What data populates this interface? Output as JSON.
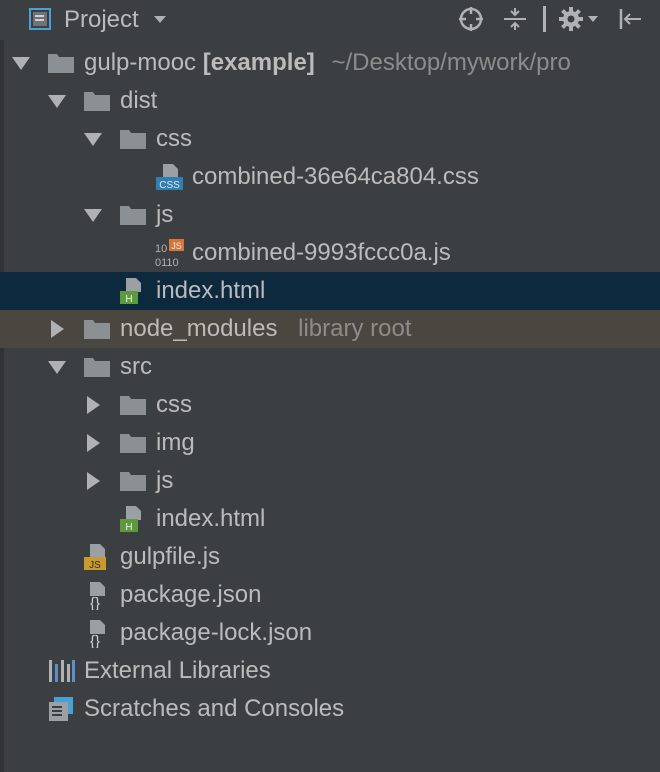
{
  "toolbar": {
    "title": "Project",
    "icons": [
      "project-view-icon",
      "dropdown-caret-icon",
      "locate-icon",
      "collapse-all-icon",
      "gear-icon",
      "hide-panel-icon"
    ]
  },
  "tree": {
    "root": {
      "name": "gulp-mooc",
      "module": "[example]",
      "path": "~/Desktop/mywork/pro"
    },
    "dist": "dist",
    "dist_css": "css",
    "dist_css_file": "combined-36e64ca804.css",
    "dist_js": "js",
    "dist_js_file": "combined-9993fccc0a.js",
    "dist_index": "index.html",
    "node_modules": "node_modules",
    "node_modules_hint": "library root",
    "src": "src",
    "src_css": "css",
    "src_img": "img",
    "src_js": "js",
    "src_index": "index.html",
    "gulpfile": "gulpfile.js",
    "package": "package.json",
    "package_lock": "package-lock.json",
    "external_libraries": "External Libraries",
    "scratches": "Scratches and Consoles"
  },
  "colors": {
    "background": "#3c3f41",
    "selected_row": "#0d293e",
    "library_root_row": "#4a4640",
    "folder": "#8a9094",
    "text": "#bbbbbb",
    "dim_text": "#8c8c8c"
  }
}
